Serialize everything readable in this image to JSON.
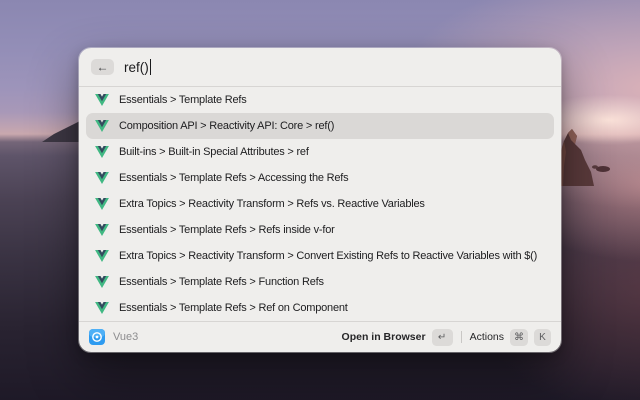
{
  "window": {
    "search": {
      "query": "ref()",
      "back_icon": "←"
    },
    "results": [
      {
        "label": "Essentials > Template Refs",
        "selected": false
      },
      {
        "label": "Composition API > Reactivity API: Core > ref()",
        "selected": true
      },
      {
        "label": "Built-ins > Built-in Special Attributes > ref",
        "selected": false
      },
      {
        "label": "Essentials > Template Refs > Accessing the Refs",
        "selected": false
      },
      {
        "label": "Extra Topics > Reactivity Transform > Refs vs. Reactive Variables",
        "selected": false
      },
      {
        "label": "Essentials > Template Refs > Refs inside v-for",
        "selected": false
      },
      {
        "label": "Extra Topics > Reactivity Transform > Convert Existing Refs to Reactive Variables with $()",
        "selected": false
      },
      {
        "label": "Essentials > Template Refs > Function Refs",
        "selected": false
      },
      {
        "label": "Essentials > Template Refs > Ref on Component",
        "selected": false
      }
    ],
    "footer": {
      "source_label": "Vue3",
      "primary_action": "Open in Browser",
      "primary_key": "↵",
      "secondary_action": "Actions",
      "secondary_keys": [
        "⌘",
        "K"
      ]
    }
  },
  "colors": {
    "vue_green": "#41b883",
    "vue_navy": "#34495e",
    "panel_bg": "#efeeec",
    "selected_row": "#dad8d6",
    "key_pill_bg": "#dcdad8",
    "extension_icon_blue": "#2e9bf0"
  },
  "icons": {
    "result_icon": "vue-logo",
    "footer_app_icon": "vue3-extension"
  }
}
